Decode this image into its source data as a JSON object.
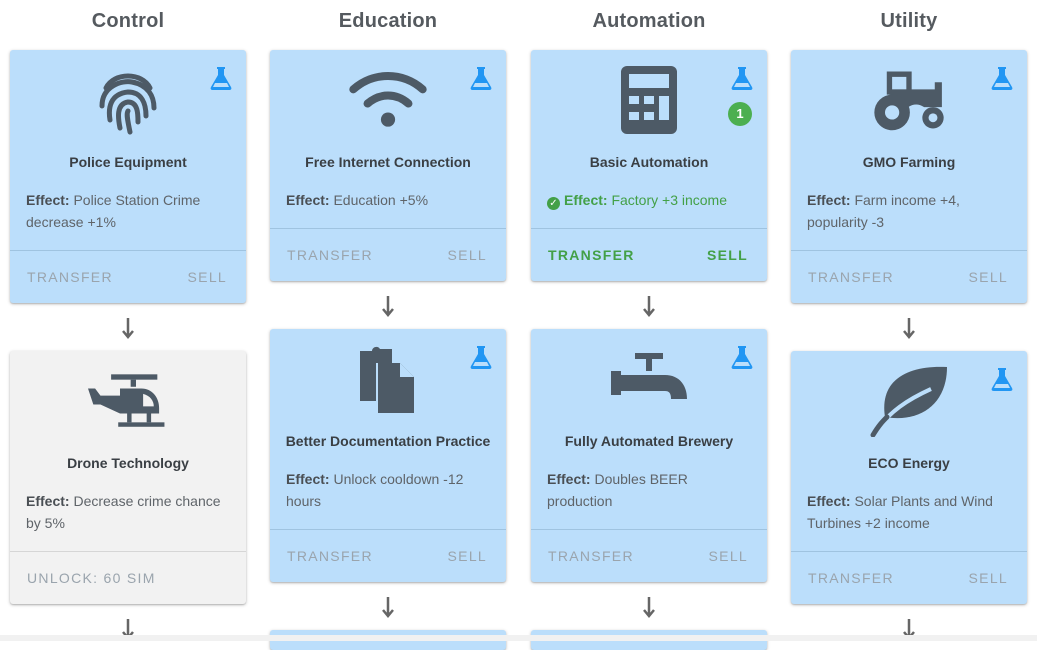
{
  "columns": [
    {
      "title": "Control",
      "cards": [
        {
          "name": "Police Equipment",
          "effect_label": "Effect:",
          "effect_text": "Police Station Crime decrease +1%",
          "transfer": "TRANSFER",
          "sell": "SELL"
        },
        {
          "name": "Drone Technology",
          "effect_label": "Effect:",
          "effect_text": "Decrease crime chance by 5%",
          "unlock": "UNLOCK: 60 SIM"
        }
      ]
    },
    {
      "title": "Education",
      "cards": [
        {
          "name": "Free Internet Connection",
          "effect_label": "Effect:",
          "effect_text": "Education +5%",
          "transfer": "TRANSFER",
          "sell": "SELL"
        },
        {
          "name": "Better Documentation Practice",
          "effect_label": "Effect:",
          "effect_text": "Unlock cooldown -12 hours",
          "transfer": "TRANSFER",
          "sell": "SELL"
        }
      ]
    },
    {
      "title": "Automation",
      "cards": [
        {
          "name": "Basic Automation",
          "effect_label": "Effect:",
          "effect_text": "Factory +3 income",
          "badge": "1",
          "transfer": "TRANSFER",
          "sell": "SELL"
        },
        {
          "name": "Fully Automated Brewery",
          "effect_label": "Effect:",
          "effect_text": "Doubles BEER production",
          "transfer": "TRANSFER",
          "sell": "SELL"
        }
      ]
    },
    {
      "title": "Utility",
      "cards": [
        {
          "name": "GMO Farming",
          "effect_label": "Effect:",
          "effect_text": "Farm income +4, popularity -3",
          "transfer": "TRANSFER",
          "sell": "SELL"
        },
        {
          "name": "ECO Energy",
          "effect_label": "Effect:",
          "effect_text": "Solar Plants and Wind Turbines +2 income",
          "transfer": "TRANSFER",
          "sell": "SELL"
        }
      ]
    }
  ],
  "colors": {
    "card": "#bbdefb",
    "locked_card": "#f2f2f2",
    "icon": "#4d5a66",
    "flask": "#2196f3",
    "active": "#43a047"
  },
  "icons": [
    "fingerprint-icon",
    "wifi-icon",
    "calculator-icon",
    "tractor-icon",
    "helicopter-icon",
    "documents-icon",
    "faucet-icon",
    "leaf-icon",
    "flask-icon",
    "arrow-down-icon",
    "check-circle-icon"
  ]
}
